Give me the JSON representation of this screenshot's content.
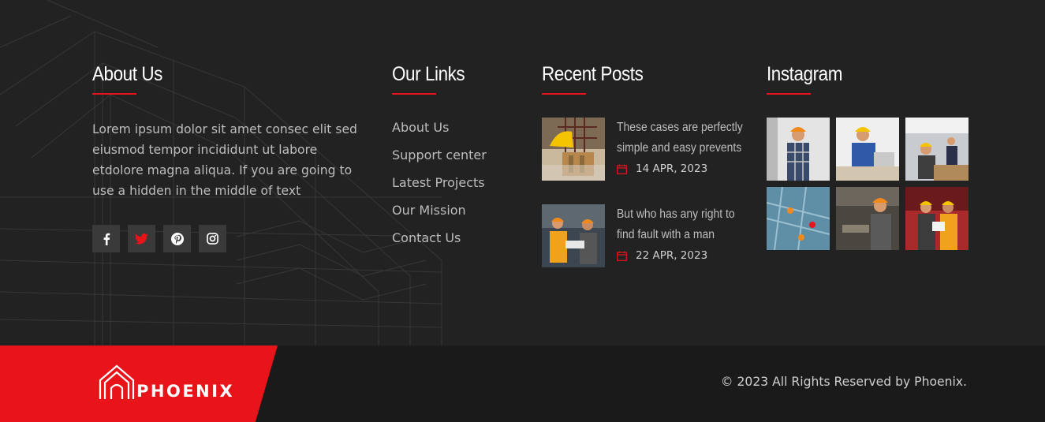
{
  "colors": {
    "accent": "#e8141a",
    "background": "#222222",
    "bottom_bar": "#1a1a1a"
  },
  "about": {
    "title": "About Us",
    "text": "Lorem ipsum dolor sit amet consec elit sed eiusmod tempor incididunt ut labore etdolore magna aliqua. If you are going to use a hidden in the middle of text",
    "socials": [
      {
        "icon": "facebook-icon"
      },
      {
        "icon": "twitter-icon"
      },
      {
        "icon": "pinterest-icon"
      },
      {
        "icon": "instagram-icon"
      }
    ]
  },
  "links": {
    "title": "Our Links",
    "items": [
      "About Us",
      "Support center",
      "Latest Projects",
      "Our Mission",
      "Contact Us"
    ]
  },
  "posts": {
    "title": "Recent Posts",
    "items": [
      {
        "title_line1": "These cases are perfectly",
        "title_line2": "simple and easy prevents",
        "date": "14 APR, 2023",
        "icon": "calendar-icon"
      },
      {
        "title_line1": "But who has any right to",
        "title_line2": "find fault with a man",
        "date": "22 APR, 2023",
        "icon": "calendar-icon"
      }
    ]
  },
  "instagram": {
    "title": "Instagram"
  },
  "footer": {
    "brand": "PHOENIX",
    "copyright": "© 2023 All Rights Reserved by Phoenix."
  }
}
